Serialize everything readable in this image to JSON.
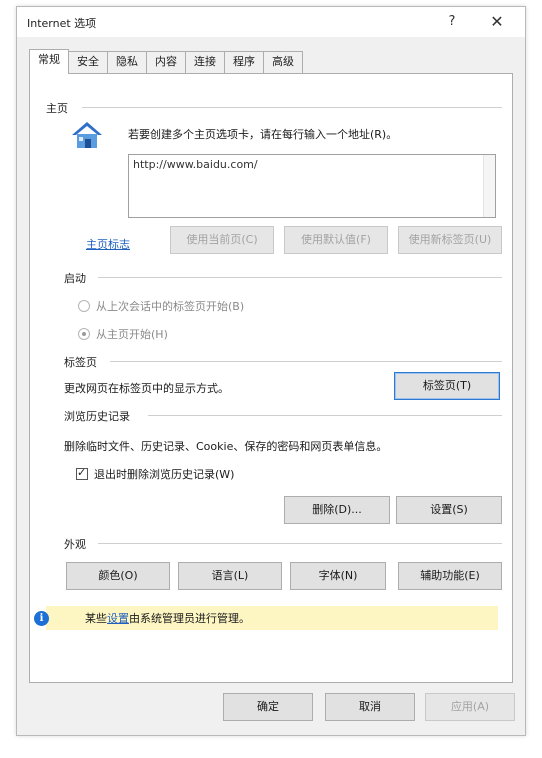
{
  "window": {
    "title": "Internet 选项",
    "help": "?",
    "close": "✕"
  },
  "tabs": [
    "常规",
    "安全",
    "隐私",
    "内容",
    "连接",
    "程序",
    "高级"
  ],
  "homepage": {
    "section_title": "主页",
    "description": "若要创建多个主页选项卡，请在每行输入一个地址(R)。",
    "url": "http://www.baidu.com/",
    "icon": "house-icon",
    "link": "主页标志",
    "buttons": [
      "使用当前页(C)",
      "使用默认值(F)",
      "使用新标签页(U)"
    ]
  },
  "startup": {
    "section_title": "启动",
    "options": [
      {
        "label": "从上次会话中的标签页开始(B)",
        "checked": false
      },
      {
        "label": "从主页开始(H)",
        "checked": true
      }
    ]
  },
  "tabs_section": {
    "section_title": "标签页",
    "description": "更改网页在标签页中的显示方式。",
    "button": "标签页(T)"
  },
  "history": {
    "section_title": "浏览历史记录",
    "description": "删除临时文件、历史记录、Cookie、保存的密码和网页表单信息。",
    "checkbox_label": "退出时删除浏览历史记录(W)",
    "checkbox_checked": true,
    "checkbox_mark": "✓",
    "delete_button": "删除(D)...",
    "settings_button": "设置(S)"
  },
  "appearance": {
    "section_title": "外观",
    "buttons": [
      "颜色(O)",
      "语言(L)",
      "字体(N)",
      "辅助功能(E)"
    ]
  },
  "info": {
    "icon": "info-icon",
    "icon_glyph": "i",
    "text_before": "某些",
    "link": "设置",
    "text_after": "由系统管理员进行管理。",
    "background": "#fdf6c3"
  },
  "footer": {
    "ok": "确定",
    "cancel": "取消",
    "apply": "应用(A)"
  }
}
